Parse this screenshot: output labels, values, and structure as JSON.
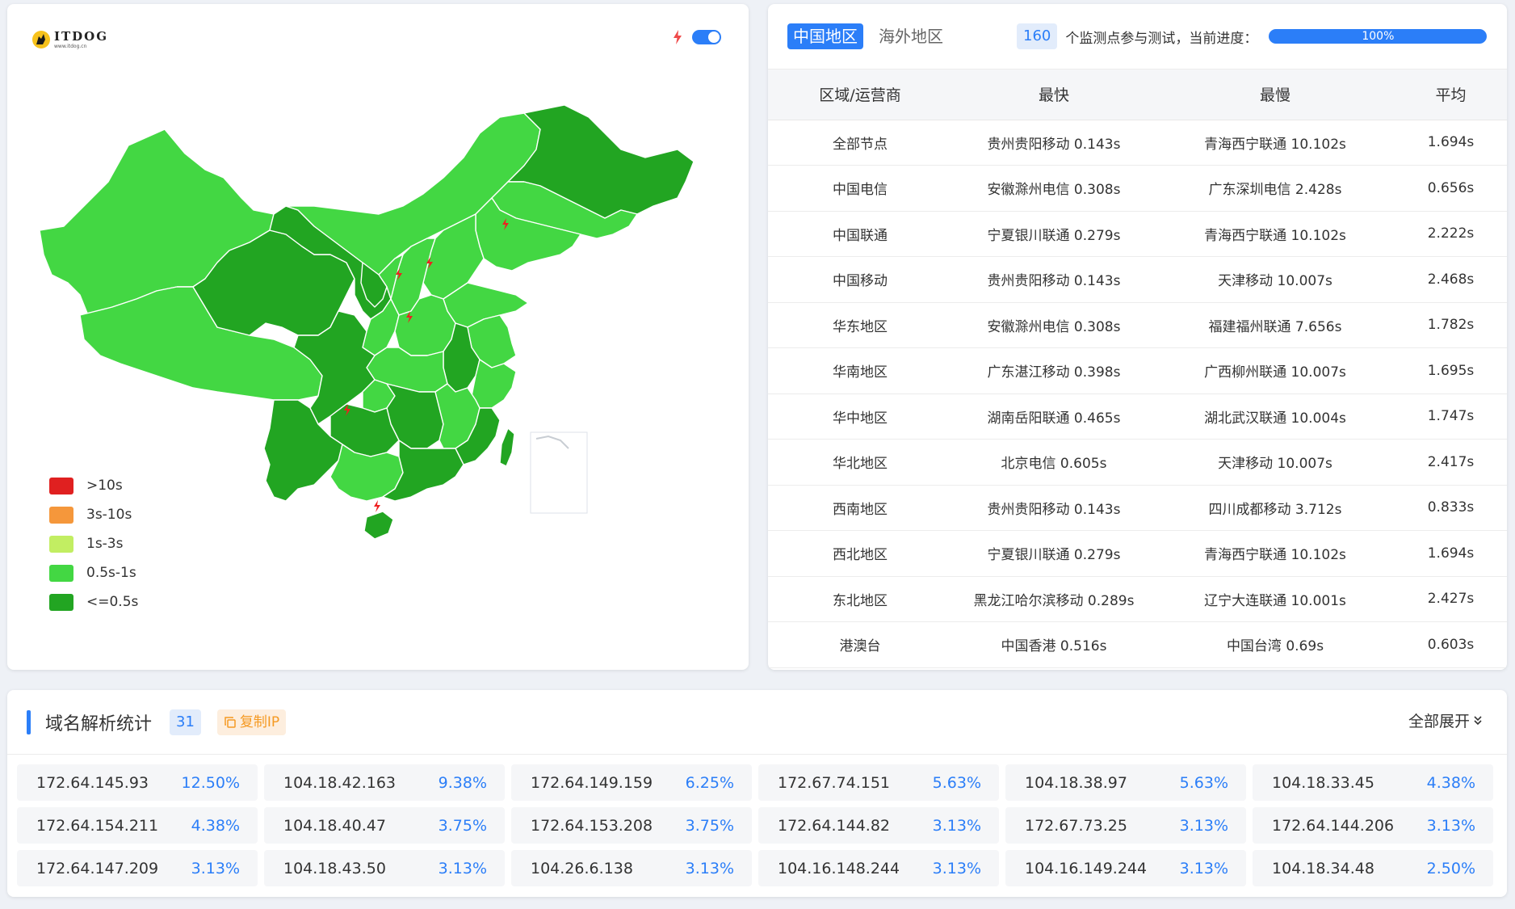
{
  "map_card": {
    "logo": {
      "name": "ITDOG",
      "url": "www.itdog.cn"
    },
    "legend": [
      {
        "label": ">10s",
        "color": "#e02020"
      },
      {
        "label": "3s-10s",
        "color": "#f5973b"
      },
      {
        "label": "1s-3s",
        "color": "#c2ee62"
      },
      {
        "label": "0.5s-1s",
        "color": "#43d743"
      },
      {
        "label": "<=0.5s",
        "color": "#22a522"
      }
    ]
  },
  "table_card": {
    "tabs": [
      {
        "label": "中国地区",
        "active": true
      },
      {
        "label": "海外地区",
        "active": false
      }
    ],
    "node_count": "160",
    "progress_text": "个监测点参与测试，当前进度：",
    "progress": "100%",
    "headers": [
      "区域/运营商",
      "最快",
      "最慢",
      "平均"
    ],
    "rows": [
      [
        "全部节点",
        "贵州贵阳移动 0.143s",
        "青海西宁联通 10.102s",
        "1.694s"
      ],
      [
        "中国电信",
        "安徽滁州电信 0.308s",
        "广东深圳电信 2.428s",
        "0.656s"
      ],
      [
        "中国联通",
        "宁夏银川联通 0.279s",
        "青海西宁联通 10.102s",
        "2.222s"
      ],
      [
        "中国移动",
        "贵州贵阳移动 0.143s",
        "天津移动 10.007s",
        "2.468s"
      ],
      [
        "华东地区",
        "安徽滁州电信 0.308s",
        "福建福州联通 7.656s",
        "1.782s"
      ],
      [
        "华南地区",
        "广东湛江移动 0.398s",
        "广西柳州联通 10.007s",
        "1.695s"
      ],
      [
        "华中地区",
        "湖南岳阳联通 0.465s",
        "湖北武汉联通 10.004s",
        "1.747s"
      ],
      [
        "华北地区",
        "北京电信 0.605s",
        "天津移动 10.007s",
        "2.417s"
      ],
      [
        "西南地区",
        "贵州贵阳移动 0.143s",
        "四川成都移动 3.712s",
        "0.833s"
      ],
      [
        "西北地区",
        "宁夏银川联通 0.279s",
        "青海西宁联通 10.102s",
        "1.694s"
      ],
      [
        "东北地区",
        "黑龙江哈尔滨移动 0.289s",
        "辽宁大连联通 10.001s",
        "2.427s"
      ],
      [
        "港澳台",
        "中国香港 0.516s",
        "中国台湾 0.69s",
        "0.603s"
      ]
    ]
  },
  "stats_card": {
    "title": "域名解析统计",
    "count": "31",
    "copy_label": "复制IP",
    "expand_label": "全部展开",
    "ips": [
      {
        "ip": "172.64.145.93",
        "pct": "12.50%"
      },
      {
        "ip": "104.18.42.163",
        "pct": "9.38%"
      },
      {
        "ip": "172.64.149.159",
        "pct": "6.25%"
      },
      {
        "ip": "172.67.74.151",
        "pct": "5.63%"
      },
      {
        "ip": "104.18.38.97",
        "pct": "5.63%"
      },
      {
        "ip": "104.18.33.45",
        "pct": "4.38%"
      },
      {
        "ip": "172.64.154.211",
        "pct": "4.38%"
      },
      {
        "ip": "104.18.40.47",
        "pct": "3.75%"
      },
      {
        "ip": "172.64.153.208",
        "pct": "3.75%"
      },
      {
        "ip": "172.64.144.82",
        "pct": "3.13%"
      },
      {
        "ip": "172.67.73.25",
        "pct": "3.13%"
      },
      {
        "ip": "172.64.144.206",
        "pct": "3.13%"
      },
      {
        "ip": "172.64.147.209",
        "pct": "3.13%"
      },
      {
        "ip": "104.18.43.50",
        "pct": "3.13%"
      },
      {
        "ip": "104.26.6.138",
        "pct": "3.13%"
      },
      {
        "ip": "104.16.148.244",
        "pct": "3.13%"
      },
      {
        "ip": "104.16.149.244",
        "pct": "3.13%"
      },
      {
        "ip": "104.18.34.48",
        "pct": "2.50%"
      }
    ]
  },
  "colors": {
    "accent": "#2b7ef8",
    "level_fast": "#22a522",
    "level_ok": "#43d743",
    "tab_bg": "#e2ecfb",
    "copy_bg": "#fdeede",
    "copy_fg": "#f59a23"
  },
  "icons": {
    "logo": "dog-logo-icon",
    "toggle": "lightning-icon",
    "copy": "copy-icon",
    "expand": "chevron-double-down-icon",
    "marker": "lightning-marker-icon"
  }
}
